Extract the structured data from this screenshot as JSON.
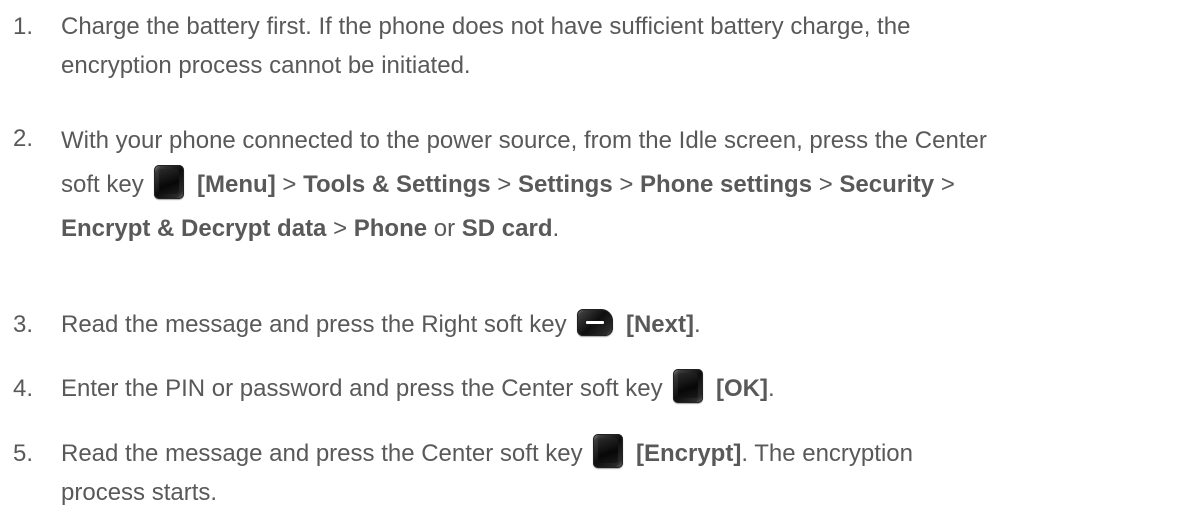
{
  "steps": [
    {
      "number": "1.",
      "line1": "Charge the battery first. If the phone does not have sufficient battery charge, the",
      "line2": "encryption process cannot be initiated."
    },
    {
      "number": "2.",
      "intro": "With your phone connected to the power source, from the Idle screen, press the Center",
      "softkey_prefix": "soft key",
      "menu": "[Menu]",
      "sep": ">",
      "path1": "Tools & Settings",
      "path2": "Settings",
      "path3": "Phone settings",
      "path4": "Security",
      "path5": "Encrypt & Decrypt data",
      "path6": "Phone",
      "or": "or",
      "path7": "SD card",
      "end": "."
    },
    {
      "number": "3.",
      "text": "Read the message and press the Right soft key",
      "key_label": "[Next]",
      "end": "."
    },
    {
      "number": "4.",
      "text": "Enter the PIN or password and press the Center soft key",
      "key_label": "[OK]",
      "end": "."
    },
    {
      "number": "5.",
      "text": "Read the message and press the Center soft key",
      "key_label": "[Encrypt]",
      "after": ". The encryption",
      "line2": "process starts."
    }
  ],
  "icons": {
    "center_key": "center-soft-key-icon",
    "right_key": "right-soft-key-icon"
  }
}
